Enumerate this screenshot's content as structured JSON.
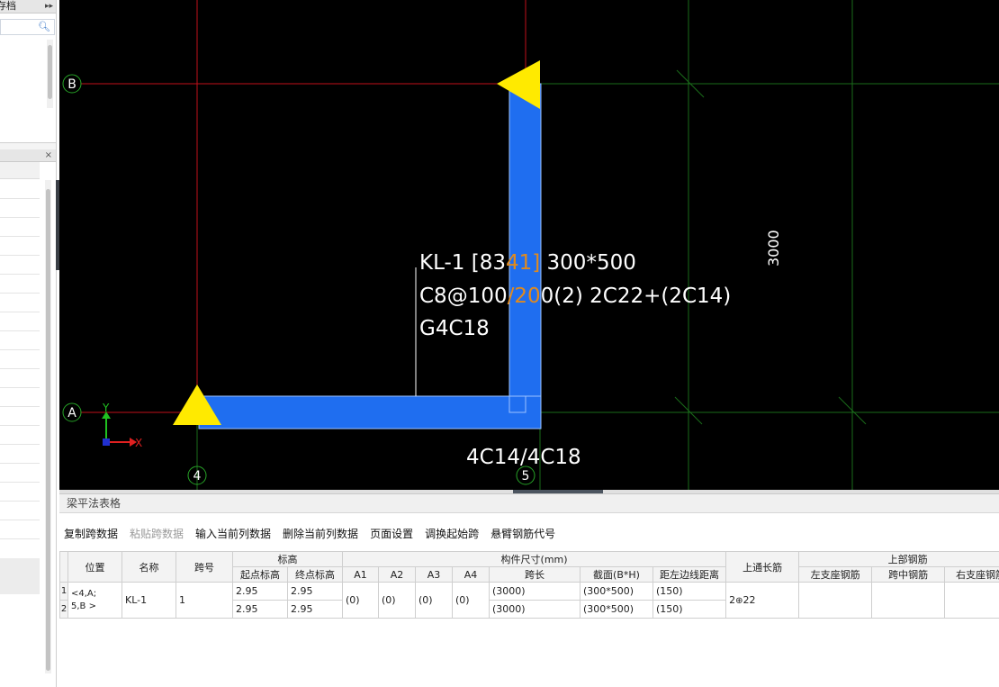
{
  "left_panel": {
    "header_label": "存档",
    "expand_glyph": "▸▸",
    "search_placeholder": "",
    "close_glyph": "×"
  },
  "canvas": {
    "axis_labels": {
      "row_b": "B",
      "row_a": "A",
      "col_4": "4",
      "col_5": "5"
    },
    "dimension_label": "3000",
    "ucs": {
      "x_label": "X",
      "y_label": "Y"
    },
    "annotation": {
      "line1_a": "KL-1 [83",
      "line1_b": "41]",
      "line1_c": " 300*500",
      "line2_a": "C8@100",
      "line2_b": "/20",
      "line2_c": "0(2) 2C22+(2C14)",
      "line3": "G4C18",
      "bottom": "4C14/4C18"
    },
    "colors": {
      "beam": "#1f6ef0",
      "support": "#ffea00",
      "axis_red": "#c0101a",
      "grid_green": "#1a6b1a",
      "highlight": "#e08a1e"
    }
  },
  "table": {
    "title": "梁平法表格",
    "toolbar": [
      {
        "label": "复制跨数据",
        "enabled": true
      },
      {
        "label": "粘贴跨数据",
        "enabled": false
      },
      {
        "label": "输入当前列数据",
        "enabled": true
      },
      {
        "label": "删除当前列数据",
        "enabled": true
      },
      {
        "label": "页面设置",
        "enabled": true
      },
      {
        "label": "调换起始跨",
        "enabled": true
      },
      {
        "label": "悬臂钢筋代号",
        "enabled": true
      }
    ],
    "headers": {
      "position": "位置",
      "name": "名称",
      "span_no": "跨号",
      "elevation": "标高",
      "start_elev": "起点标高",
      "end_elev": "终点标高",
      "member_size": "构件尺寸(mm)",
      "a1": "A1",
      "a2": "A2",
      "a3": "A3",
      "a4": "A4",
      "span_len": "跨长",
      "section": "截面(B*H)",
      "edge_dist": "距左边线距离",
      "top_through": "上通长筋",
      "top_rebar": "上部钢筋",
      "left_support": "左支座钢筋",
      "mid_span": "跨中钢筋",
      "right_support": "右支座钢筋"
    },
    "row_numbers": [
      "1",
      "2"
    ],
    "position_lines": [
      "<4,A;",
      "5,B >"
    ],
    "name": "KL-1",
    "span_no": "1",
    "a_values": [
      "(0)",
      "(0)",
      "(0)",
      "(0)"
    ],
    "rows": [
      {
        "start_elev": "2.95",
        "end_elev": "2.95",
        "span_len": "(3000)",
        "section": "(300*500)",
        "edge_dist": "(150)"
      },
      {
        "start_elev": "2.95",
        "end_elev": "2.95",
        "span_len": "(3000)",
        "section": "(300*500)",
        "edge_dist": "(150)"
      }
    ],
    "top_through_count": "2",
    "top_through_glyph": "⊕",
    "top_through_dia": "22"
  }
}
